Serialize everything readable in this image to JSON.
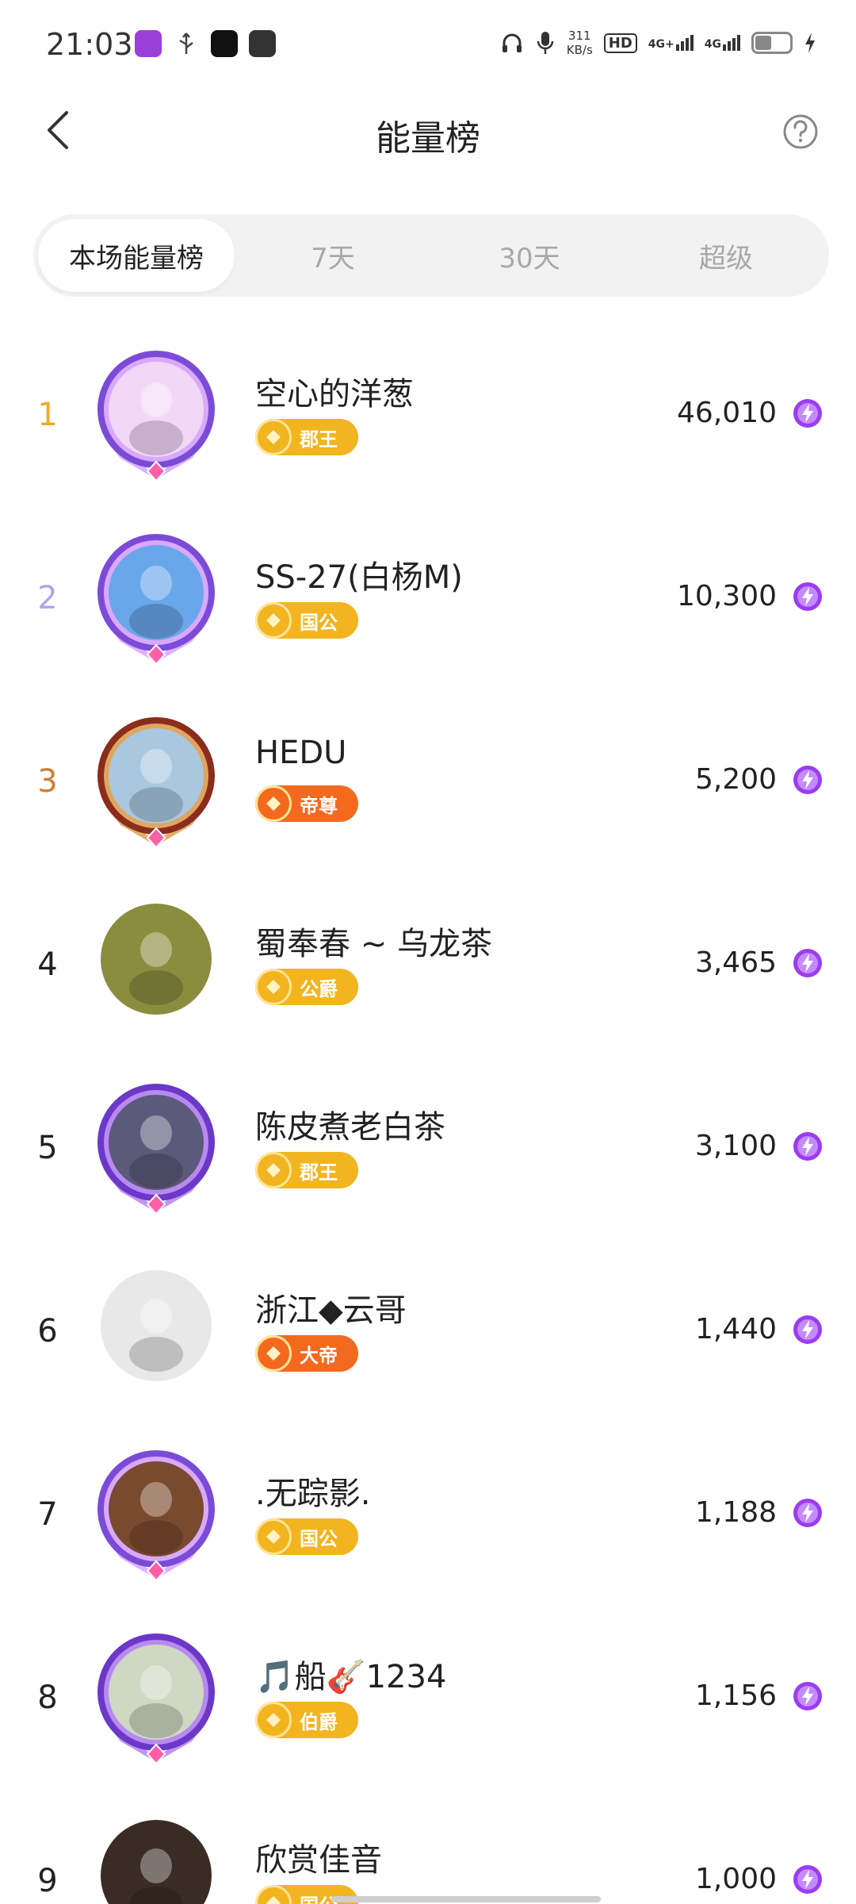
{
  "status_bar": {
    "time": "21:03",
    "net_speed_value": "311",
    "net_speed_unit": "KB/s",
    "hd_label": "HD",
    "net1": "4G+",
    "net2": "4G",
    "icons": [
      "app-icon-purple",
      "usb-icon",
      "tiktok-icon",
      "chat-app-icon",
      "headphones-icon",
      "microphone-icon",
      "battery-icon",
      "charging-icon"
    ]
  },
  "header": {
    "title": "能量榜"
  },
  "tabs": [
    {
      "label": "本场能量榜",
      "active": true
    },
    {
      "label": "7天",
      "active": false
    },
    {
      "label": "30天",
      "active": false
    },
    {
      "label": "超级",
      "active": false
    }
  ],
  "colors": {
    "rank1": "#f0a928",
    "rank2": "#a9a8ec",
    "rank3": "#d17e36",
    "badge_gold": "#f2b41f",
    "badge_orange": "#f36a1e",
    "energy": "#9b3cf0"
  },
  "leaderboard": [
    {
      "rank": "1",
      "name": "空心的洋葱",
      "badge": "郡王",
      "badge_type": "gold",
      "score": "46,010"
    },
    {
      "rank": "2",
      "name": "SS-27(白杨M)",
      "badge": "国公",
      "badge_type": "gold",
      "score": "10,300"
    },
    {
      "rank": "3",
      "name": "HEDU",
      "badge": "帝尊",
      "badge_type": "orange",
      "score": "5,200"
    },
    {
      "rank": "4",
      "name": "蜀奉春 ~ 乌龙茶",
      "badge": "公爵",
      "badge_type": "gold",
      "score": "3,465"
    },
    {
      "rank": "5",
      "name": "陈皮煮老白茶",
      "badge": "郡王",
      "badge_type": "gold",
      "score": "3,100"
    },
    {
      "rank": "6",
      "name": "浙江◆云哥",
      "badge": "大帝",
      "badge_type": "orange",
      "score": "1,440"
    },
    {
      "rank": "7",
      "name": ".无踪影.",
      "badge": "国公",
      "badge_type": "gold",
      "score": "1,188"
    },
    {
      "rank": "8",
      "name": "🎵船🎸1234",
      "badge": "伯爵",
      "badge_type": "gold",
      "score": "1,156"
    },
    {
      "rank": "9",
      "name": "欣赏佳音",
      "badge": "国公",
      "badge_type": "gold",
      "score": "1,000"
    }
  ]
}
